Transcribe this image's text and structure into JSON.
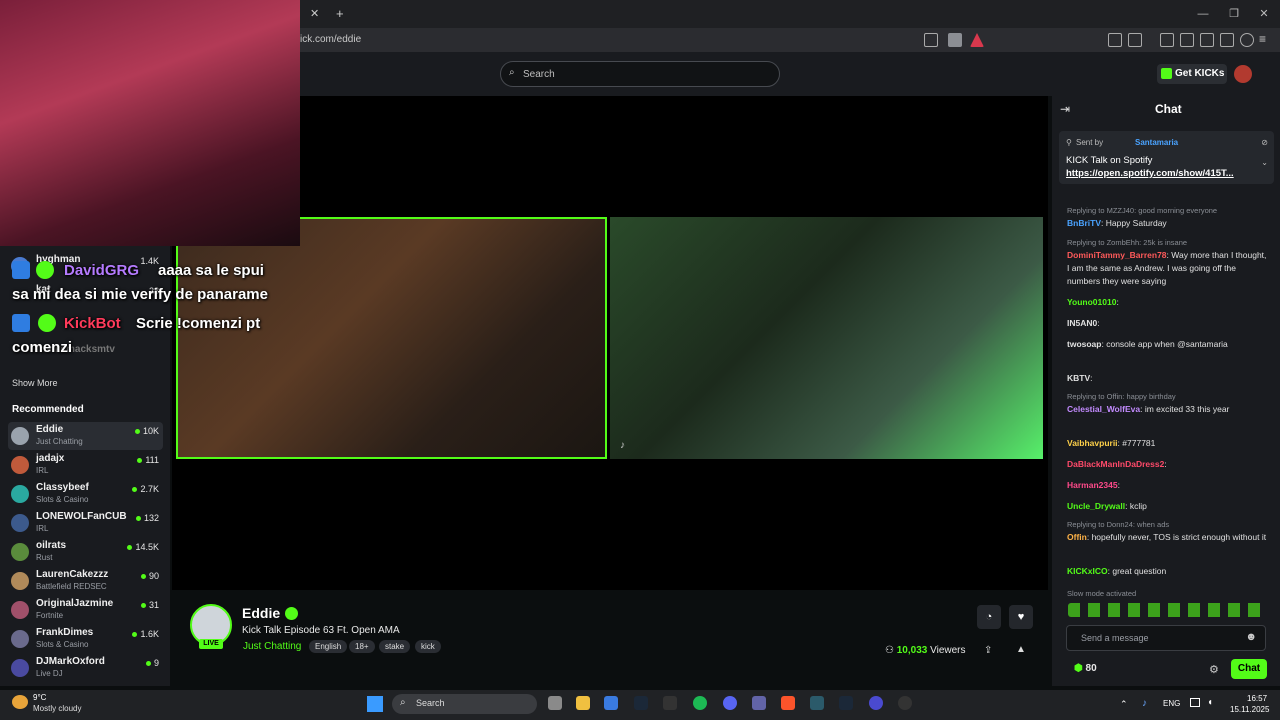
{
  "browser": {
    "url": "ick.com/eddie"
  },
  "header": {
    "search_placeholder": "Search",
    "get_kicks_label": "Get KICKs"
  },
  "overlay_chat": [
    {
      "user": "DavidGRG",
      "text": "aaaa sa le spui",
      "text2": "sa mi dea si mie verify de panarame"
    },
    {
      "user": "KickBot",
      "text": "Scrie !comenzi pt",
      "text2": "comenzi"
    }
  ],
  "sidebar": {
    "partial_items": [
      {
        "name": "hyghman",
        "count": "1.4K",
        "cat": "Just Chatting"
      },
      {
        "name": "kat",
        "count": "28",
        "cat": "Just Chatting"
      },
      {
        "name": "franksmacksmtv",
        "count": "",
        "cat": ""
      }
    ],
    "show_more": "Show More",
    "recommended_heading": "Recommended",
    "recommended": [
      {
        "name": "Eddie",
        "cat": "Just Chatting",
        "count": "10K"
      },
      {
        "name": "jadajx",
        "cat": "IRL",
        "count": "111"
      },
      {
        "name": "Classybeef",
        "cat": "Slots & Casino",
        "count": "2.7K"
      },
      {
        "name": "LONEWOLFanCUB",
        "cat": "IRL",
        "count": "132"
      },
      {
        "name": "oilrats",
        "cat": "Rust",
        "count": "14.5K"
      },
      {
        "name": "LaurenCakezzz",
        "cat": "Battlefield REDSEC",
        "count": "90"
      },
      {
        "name": "OriginalJazmine",
        "cat": "Fortnite",
        "count": "31"
      },
      {
        "name": "FrankDimes",
        "cat": "Slots & Casino",
        "count": "1.6K"
      },
      {
        "name": "DJMarkOxford",
        "cat": "Live DJ",
        "count": "9"
      }
    ]
  },
  "stream": {
    "channel": "Eddie",
    "live_label": "LIVE",
    "title": "Kick Talk Episode 63 Ft. Open AMA",
    "category": "Just Chatting",
    "tags": [
      "English",
      "18+",
      "stake",
      "kick"
    ],
    "viewers_count": "10,033",
    "viewers_label": "Viewers"
  },
  "chat": {
    "title": "Chat",
    "pinned": {
      "sent_by": "Sent by",
      "sender": "Santamaria",
      "line1": "KICK Talk on Spotify",
      "link": "https://open.spotify.com/show/415T..."
    },
    "messages": [
      {
        "reply": "Replying to MZZJ40: good morning everyone",
        "user": "BnBriTV",
        "text": "Happy Saturday",
        "color": "#4aa3ff"
      },
      {
        "reply": "Replying to ZombEhh: 25k is insane",
        "user": "DominiTammy_Barren78",
        "text": "Way more than I thought, I am the same as Andrew. I was going off the numbers they were saying",
        "color": "#ff5a5a"
      },
      {
        "reply": "",
        "user": "Youno01010",
        "text": "",
        "color": "#53fc18"
      },
      {
        "reply": "",
        "user": "IN5AN0",
        "text": "",
        "color": "#e8e8e8"
      },
      {
        "reply": "",
        "user": "twosoap",
        "text": "console app when @santamaria",
        "color": "#e8e8e8"
      },
      {
        "reply": "",
        "user": "KBTV",
        "text": "",
        "color": "#e8e8e8"
      },
      {
        "reply": "Replying to Offin: happy birthday",
        "user": "Celestial_WolfEva",
        "text": "im excited 33 this year",
        "color": "#c38bff"
      },
      {
        "reply": "",
        "user": "Vaibhavpurii",
        "text": "#777781",
        "color": "#ffd24a"
      },
      {
        "reply": "",
        "user": "DaBlackManInDaDress2",
        "text": "",
        "color": "#ff4a6a"
      },
      {
        "reply": "",
        "user": "Harman2345",
        "text": "",
        "color": "#ff4a8a"
      },
      {
        "reply": "",
        "user": "Uncle_Drywall",
        "text": "kclip",
        "color": "#53fc18"
      },
      {
        "reply": "Replying to Donn24: when ads",
        "user": "Offin",
        "text": "hopefully never, TOS is strict enough without it",
        "color": "#ffb347"
      },
      {
        "reply": "",
        "user": "KICKxICO",
        "text": "great question",
        "color": "#53fc18"
      }
    ],
    "slow_mode": "Slow mode activated",
    "send_placeholder": "Send a message",
    "points": "80",
    "send_button": "Chat"
  },
  "taskbar": {
    "weather_temp": "9°C",
    "weather_cond": "Mostly cloudy",
    "search_placeholder": "Search",
    "lang": "ENG",
    "time": "16:57",
    "date": "15.11.2025"
  }
}
